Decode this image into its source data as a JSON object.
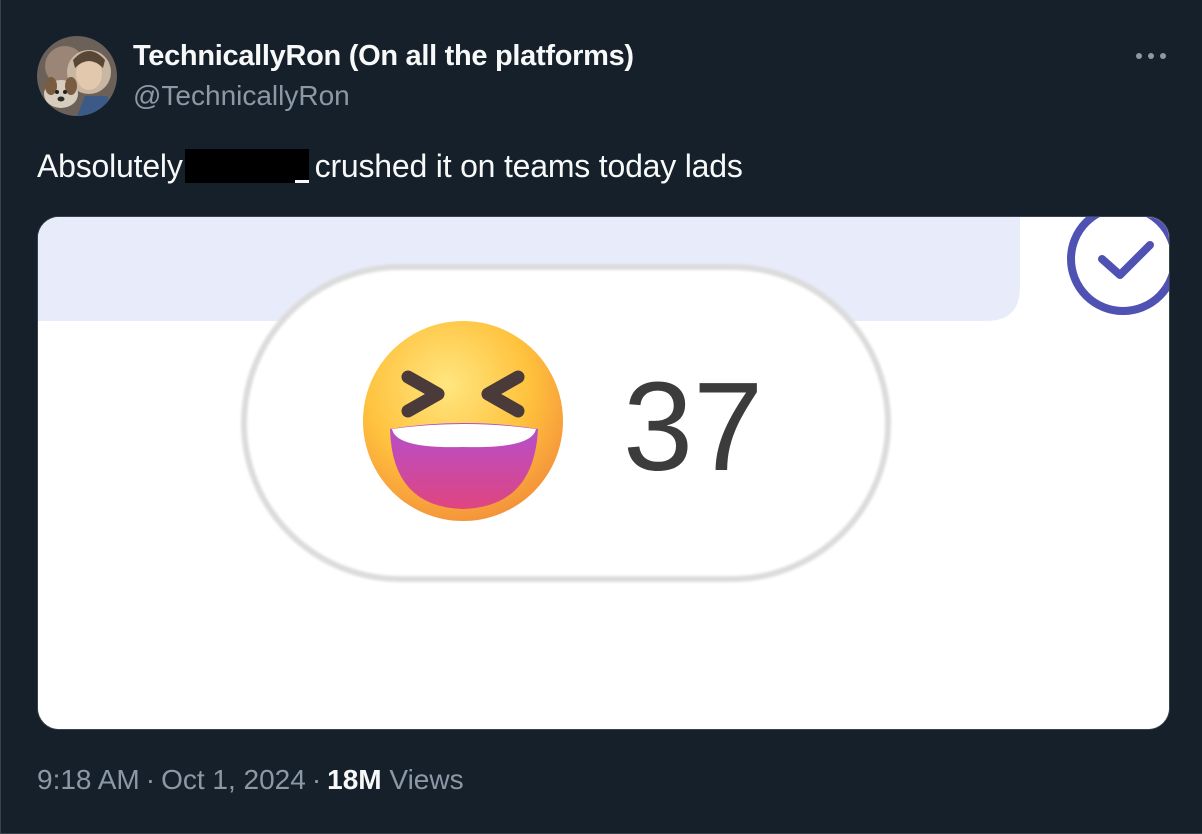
{
  "author": {
    "display_name": "TechnicallyRon (On all the platforms)",
    "handle": "@TechnicallyRon"
  },
  "tweet": {
    "text_before": "Absolutely",
    "text_after": "crushed it on teams today lads"
  },
  "media": {
    "reaction_emoji": "grinning-squinting-face-icon",
    "reaction_count": "37",
    "checkmark": "check-circle-icon"
  },
  "meta": {
    "time": "9:18 AM",
    "separator": "·",
    "date": "Oct 1, 2024",
    "views_count": "18M",
    "views_label": "Views"
  },
  "colors": {
    "background": "#15202b",
    "text_primary": "#f7f9f9",
    "text_secondary": "#8b98a5",
    "border": "#38444d",
    "teams_accent": "#4f52b2",
    "teams_bubble": "#e8ebfa"
  }
}
